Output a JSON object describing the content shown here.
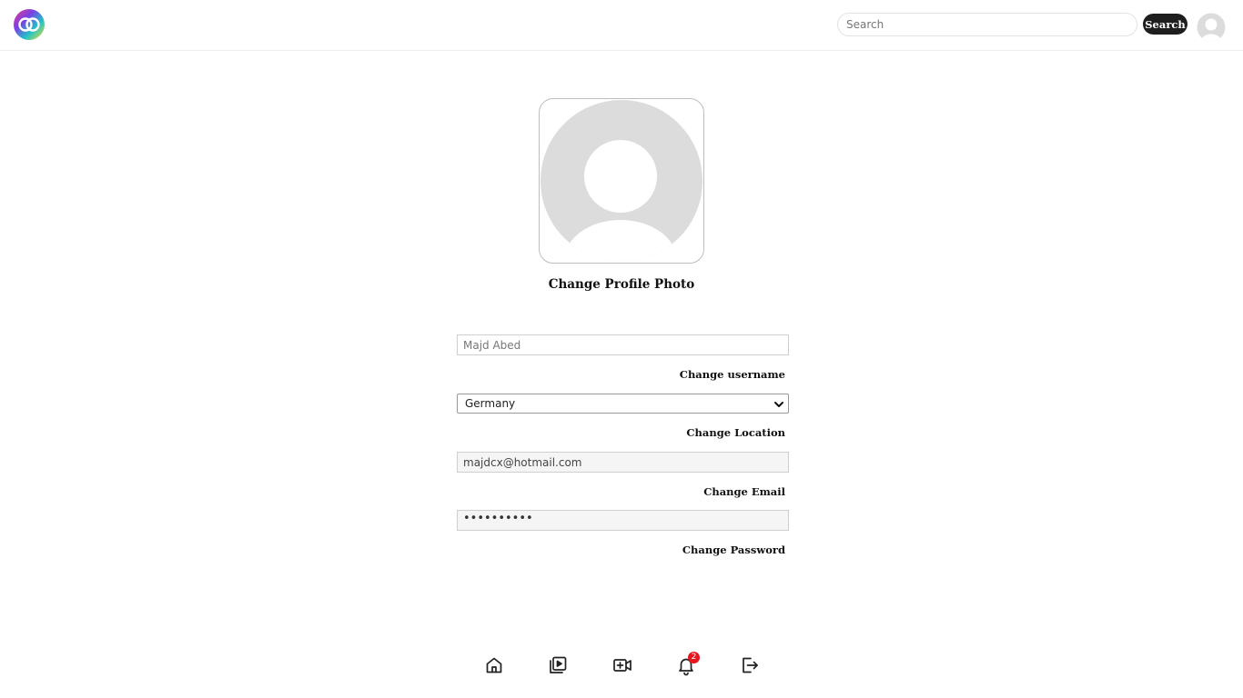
{
  "header": {
    "search": {
      "placeholder": "Search",
      "value": ""
    },
    "search_button_label": "Search"
  },
  "profile": {
    "change_photo_label": "Change Profile Photo"
  },
  "form": {
    "username": {
      "placeholder": "Majd Abed",
      "value": "",
      "action_label": "Change username"
    },
    "location": {
      "selected": "Germany",
      "action_label": "Change Location"
    },
    "email": {
      "value": "majdcx@hotmail.com",
      "action_label": "Change Email"
    },
    "password": {
      "masked_value": "••••••••••",
      "action_label": "Change Password"
    }
  },
  "bottom_nav": {
    "items": [
      "home-icon",
      "playlist-icon",
      "add-video-icon",
      "bell-icon",
      "logout-icon"
    ],
    "notification_count": "2"
  },
  "colors": {
    "button_dark": "#1e1e1e",
    "badge_red": "#e8141e",
    "placeholder_gray": "#dcdcdc"
  }
}
